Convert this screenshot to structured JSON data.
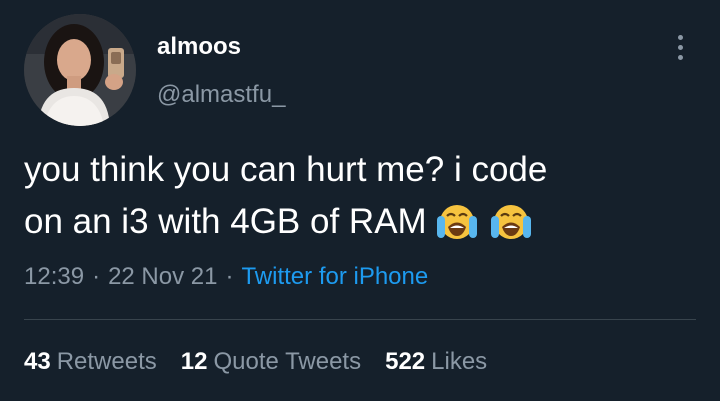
{
  "tweet": {
    "author_name": "almoos",
    "author_handle": "@almastfu_",
    "text_line1": "you think you can hurt me? i code",
    "text_line2": "on an i3 with 4GB of RAM",
    "emoji": [
      "loudly-crying-face-emoji",
      "loudly-crying-face-emoji"
    ],
    "time": "12:39",
    "date": "22 Nov 21",
    "separator": "·",
    "source": "Twitter for iPhone"
  },
  "stats": {
    "retweets_count": "43",
    "retweets_label": "Retweets",
    "quotes_count": "12",
    "quotes_label": "Quote Tweets",
    "likes_count": "522",
    "likes_label": "Likes"
  },
  "icons": {
    "more": "more-vertical-icon"
  },
  "colors": {
    "background": "#15202b",
    "text_primary": "#ffffff",
    "text_secondary": "#8b98a5",
    "link": "#1d9bf0",
    "divider": "#38444d"
  }
}
